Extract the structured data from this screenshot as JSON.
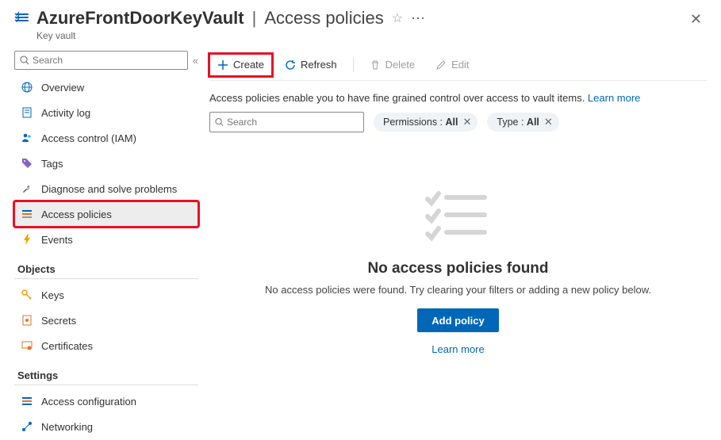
{
  "header": {
    "resource_name": "AzureFrontDoorKeyVault",
    "blade_title": "Access policies",
    "resource_type": "Key vault"
  },
  "sidebar": {
    "search_placeholder": "Search",
    "items": [
      {
        "label": "Overview",
        "icon": "globe"
      },
      {
        "label": "Activity log",
        "icon": "log"
      },
      {
        "label": "Access control (IAM)",
        "icon": "iam"
      },
      {
        "label": "Tags",
        "icon": "tag"
      },
      {
        "label": "Diagnose and solve problems",
        "icon": "wrench"
      },
      {
        "label": "Access policies",
        "icon": "policies",
        "selected": true,
        "highlighted": true
      },
      {
        "label": "Events",
        "icon": "bolt"
      }
    ],
    "groups": [
      {
        "title": "Objects",
        "items": [
          {
            "label": "Keys",
            "icon": "key"
          },
          {
            "label": "Secrets",
            "icon": "secret"
          },
          {
            "label": "Certificates",
            "icon": "cert"
          }
        ]
      },
      {
        "title": "Settings",
        "items": [
          {
            "label": "Access configuration",
            "icon": "sliders"
          },
          {
            "label": "Networking",
            "icon": "net"
          }
        ]
      }
    ]
  },
  "toolbar": {
    "create_label": "Create",
    "refresh_label": "Refresh",
    "delete_label": "Delete",
    "edit_label": "Edit"
  },
  "info": {
    "text": "Access policies enable you to have fine grained control over access to vault items. ",
    "learn_more": "Learn more"
  },
  "filters": {
    "search_placeholder": "Search",
    "permissions_label": "Permissions : ",
    "permissions_value": "All",
    "type_label": "Type : ",
    "type_value": "All"
  },
  "empty": {
    "title": "No access policies found",
    "subtitle": "No access policies were found. Try clearing your filters or adding a new policy below.",
    "add_button": "Add policy",
    "learn_more": "Learn more"
  }
}
